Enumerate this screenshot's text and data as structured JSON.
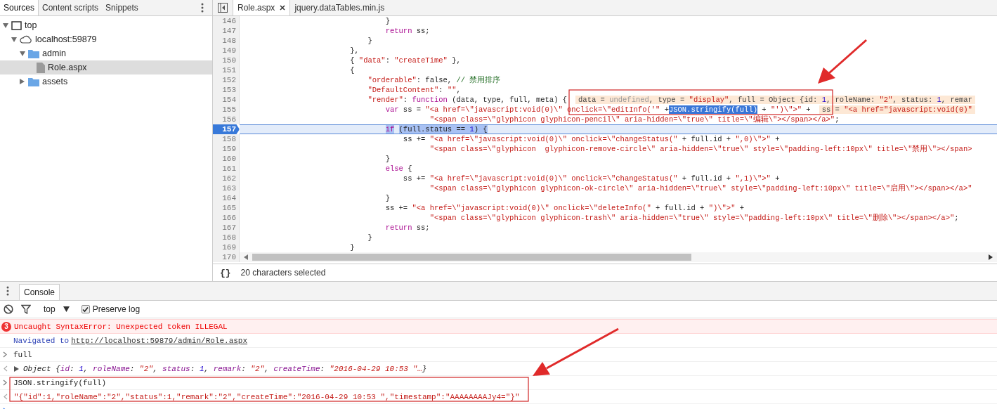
{
  "navigator": {
    "tabs": [
      {
        "label": "Sources",
        "selected": true
      },
      {
        "label": "Content scripts",
        "selected": false
      },
      {
        "label": "Snippets",
        "selected": false
      }
    ],
    "tree": [
      {
        "label": "top",
        "kind": "frame",
        "expanded": true,
        "selected": false,
        "children": [
          {
            "label": "localhost:59879",
            "kind": "cloud",
            "expanded": true,
            "selected": false,
            "children": [
              {
                "label": "admin",
                "kind": "folder",
                "expanded": true,
                "selected": false,
                "children": [
                  {
                    "label": "Role.aspx",
                    "kind": "file",
                    "selected": true
                  }
                ]
              },
              {
                "label": "assets",
                "kind": "folder",
                "expanded": false,
                "selected": false
              }
            ]
          }
        ]
      }
    ]
  },
  "editor": {
    "tabs": [
      {
        "label": "Role.aspx",
        "selected": true,
        "closable": true
      },
      {
        "label": "jquery.dataTables.min.js",
        "selected": false,
        "closable": false
      }
    ],
    "lines": [
      {
        "number": "146",
        "paused": false,
        "tokens": [
          {
            "kind": "plain",
            "text": "                                }"
          }
        ]
      },
      {
        "number": "147",
        "paused": false,
        "tokens": [
          {
            "kind": "keyword",
            "text": "                                return"
          },
          {
            "kind": "plain",
            "text": " ss;"
          }
        ]
      },
      {
        "number": "148",
        "paused": false,
        "tokens": [
          {
            "kind": "plain",
            "text": "                            }"
          }
        ]
      },
      {
        "number": "149",
        "paused": false,
        "tokens": [
          {
            "kind": "plain",
            "text": "                        },"
          }
        ]
      },
      {
        "number": "150",
        "paused": false,
        "tokens": [
          {
            "kind": "plain",
            "text": "                        { "
          },
          {
            "kind": "string",
            "text": "\"data\""
          },
          {
            "kind": "plain",
            "text": ": "
          },
          {
            "kind": "string",
            "text": "\"createTime\""
          },
          {
            "kind": "plain",
            "text": " },"
          }
        ]
      },
      {
        "number": "151",
        "paused": false,
        "tokens": [
          {
            "kind": "plain",
            "text": "                        {"
          }
        ]
      },
      {
        "number": "152",
        "paused": false,
        "tokens": [
          {
            "kind": "string",
            "text": "                            \"orderable\""
          },
          {
            "kind": "plain",
            "text": ": false, "
          },
          {
            "kind": "comment",
            "text": "// 禁用排序"
          }
        ]
      },
      {
        "number": "153",
        "paused": false,
        "tokens": [
          {
            "kind": "string",
            "text": "                            \"DefaultContent\""
          },
          {
            "kind": "plain",
            "text": ": "
          },
          {
            "kind": "string",
            "text": "\"\""
          },
          {
            "kind": "plain",
            "text": ","
          }
        ]
      },
      {
        "number": "154",
        "paused": false,
        "tokens": [
          {
            "kind": "string",
            "text": "                            \"render\""
          },
          {
            "kind": "plain",
            "text": ": "
          },
          {
            "kind": "keyword",
            "text": "function"
          },
          {
            "kind": "plain",
            "text": " (data, type, full, meta) {"
          }
        ],
        "hint": [
          {
            "kind": "plain",
            "text": "data = "
          },
          {
            "kind": "muted",
            "text": "undefined"
          },
          {
            "kind": "plain",
            "text": ", type = "
          },
          {
            "kind": "string",
            "text": "\"display\""
          },
          {
            "kind": "plain",
            "text": ", full = Object {id: "
          },
          {
            "kind": "number",
            "text": "1"
          },
          {
            "kind": "plain",
            "text": ", roleName: "
          },
          {
            "kind": "string",
            "text": "\"2\""
          },
          {
            "kind": "plain",
            "text": ", status: "
          },
          {
            "kind": "number",
            "text": "1"
          },
          {
            "kind": "plain",
            "text": ", remar"
          }
        ]
      },
      {
        "number": "155",
        "paused": false,
        "tokens": [
          {
            "kind": "keyword",
            "text": "                                var"
          },
          {
            "kind": "plain",
            "text": " ss = "
          },
          {
            "kind": "string",
            "text": "\"<a href=\\\"javascript:void(0)\\\" onclick=\\\"editInfo('\""
          },
          {
            "kind": "plain",
            "text": " +"
          },
          {
            "kind": "selected",
            "text": "JSON.stringify(full)"
          },
          {
            "kind": "plain",
            "text": " + "
          },
          {
            "kind": "string",
            "text": "\"')\\\">\""
          },
          {
            "kind": "plain",
            "text": " +"
          }
        ],
        "hint": [
          {
            "kind": "plain",
            "text": "ss = "
          },
          {
            "kind": "string",
            "text": "\"<a href=\"javascript:void(0)\""
          }
        ]
      },
      {
        "number": "156",
        "paused": false,
        "tokens": [
          {
            "kind": "string",
            "text": "                                          \"<span class=\\\"glyphicon glyphicon-pencil\\\" aria-hidden=\\\"true\\\" title=\\\"编辑\\\"></span></a>\""
          },
          {
            "kind": "plain",
            "text": ";"
          }
        ]
      },
      {
        "number": "157",
        "paused": true,
        "tokens": [
          {
            "kind": "keyword",
            "text": "                                if"
          },
          {
            "kind": "plain",
            "text": " (full.status == "
          },
          {
            "kind": "number",
            "text": "1"
          },
          {
            "kind": "plain",
            "text": ") {"
          }
        ]
      },
      {
        "number": "158",
        "paused": false,
        "tokens": [
          {
            "kind": "plain",
            "text": "                                    ss += "
          },
          {
            "kind": "string",
            "text": "\"<a href=\\\"javascript:void(0)\\\" onclick=\\\"changeStatus(\""
          },
          {
            "kind": "plain",
            "text": " + full.id + "
          },
          {
            "kind": "string",
            "text": "\",0)\\\">\""
          },
          {
            "kind": "plain",
            "text": " +"
          }
        ]
      },
      {
        "number": "159",
        "paused": false,
        "tokens": [
          {
            "kind": "string",
            "text": "                                          \"<span class=\\\"glyphicon  glyphicon-remove-circle\\\" aria-hidden=\\\"true\\\" style=\\\"padding-left:10px\\\" title=\\\"禁用\\\"></span>"
          }
        ]
      },
      {
        "number": "160",
        "paused": false,
        "tokens": [
          {
            "kind": "plain",
            "text": "                                }"
          }
        ]
      },
      {
        "number": "161",
        "paused": false,
        "tokens": [
          {
            "kind": "keyword",
            "text": "                                else"
          },
          {
            "kind": "plain",
            "text": " {"
          }
        ]
      },
      {
        "number": "162",
        "paused": false,
        "tokens": [
          {
            "kind": "plain",
            "text": "                                    ss += "
          },
          {
            "kind": "string",
            "text": "\"<a href=\\\"javascript:void(0)\\\" onclick=\\\"changeStatus(\""
          },
          {
            "kind": "plain",
            "text": " + full.id + "
          },
          {
            "kind": "string",
            "text": "\",1)\\\">\""
          },
          {
            "kind": "plain",
            "text": " +"
          }
        ]
      },
      {
        "number": "163",
        "paused": false,
        "tokens": [
          {
            "kind": "string",
            "text": "                                          \"<span class=\\\"glyphicon glyphicon-ok-circle\\\" aria-hidden=\\\"true\\\" style=\\\"padding-left:10px\\\" title=\\\"启用\\\"></span></a>\""
          }
        ]
      },
      {
        "number": "164",
        "paused": false,
        "tokens": [
          {
            "kind": "plain",
            "text": "                                }"
          }
        ]
      },
      {
        "number": "165",
        "paused": false,
        "tokens": [
          {
            "kind": "plain",
            "text": "                                ss += "
          },
          {
            "kind": "string",
            "text": "\"<a href=\\\"javascript:void(0)\\\" onclick=\\\"deleteInfo(\""
          },
          {
            "kind": "plain",
            "text": " + full.id + "
          },
          {
            "kind": "string",
            "text": "\")\\\">\""
          },
          {
            "kind": "plain",
            "text": " +"
          }
        ]
      },
      {
        "number": "166",
        "paused": false,
        "tokens": [
          {
            "kind": "string",
            "text": "                                          \"<span class=\\\"glyphicon glyphicon-trash\\\" aria-hidden=\\\"true\\\" style=\\\"padding-left:10px\\\" title=\\\"删除\\\"></span></a>\""
          },
          {
            "kind": "plain",
            "text": ";"
          }
        ]
      },
      {
        "number": "167",
        "paused": false,
        "tokens": [
          {
            "kind": "keyword",
            "text": "                                return"
          },
          {
            "kind": "plain",
            "text": " ss;"
          }
        ]
      },
      {
        "number": "168",
        "paused": false,
        "tokens": [
          {
            "kind": "plain",
            "text": "                            }"
          }
        ]
      },
      {
        "number": "169",
        "paused": false,
        "tokens": [
          {
            "kind": "plain",
            "text": "                        }"
          }
        ]
      }
    ],
    "last_line": {
      "number": "170"
    },
    "format_button": "{}",
    "status": "20 characters selected"
  },
  "console": {
    "tab": "Console",
    "context": "top",
    "preserve_log": {
      "label": "Preserve log",
      "checked": true
    },
    "messages": [
      {
        "kind": "error",
        "count": "3",
        "text": "Uncaught SyntaxError: Unexpected token ILLEGAL"
      },
      {
        "kind": "navigation",
        "text": "Navigated to",
        "link": "http://localhost:59879/admin/Role.aspx"
      },
      {
        "kind": "input",
        "text": "full"
      },
      {
        "kind": "object",
        "tokens": [
          {
            "kind": "plain",
            "text": "Object {"
          },
          {
            "kind": "key",
            "text": "id"
          },
          {
            "kind": "plain",
            "text": ": "
          },
          {
            "kind": "number",
            "text": "1"
          },
          {
            "kind": "plain",
            "text": ", "
          },
          {
            "kind": "key",
            "text": "roleName"
          },
          {
            "kind": "plain",
            "text": ": "
          },
          {
            "kind": "string",
            "text": "\"2\""
          },
          {
            "kind": "plain",
            "text": ", "
          },
          {
            "kind": "key",
            "text": "status"
          },
          {
            "kind": "plain",
            "text": ": "
          },
          {
            "kind": "number",
            "text": "1"
          },
          {
            "kind": "plain",
            "text": ", "
          },
          {
            "kind": "key",
            "text": "remark"
          },
          {
            "kind": "plain",
            "text": ": "
          },
          {
            "kind": "string",
            "text": "\"2\""
          },
          {
            "kind": "plain",
            "text": ", "
          },
          {
            "kind": "key",
            "text": "createTime"
          },
          {
            "kind": "plain",
            "text": ": "
          },
          {
            "kind": "string",
            "text": "\"2016-04-29 10:53 \"…"
          },
          {
            "kind": "plain",
            "text": "}"
          }
        ]
      },
      {
        "kind": "input",
        "text": "JSON.stringify(full)"
      },
      {
        "kind": "string",
        "text": "\"{\"id\":1,\"roleName\":\"2\",\"status\":1,\"remark\":\"2\",\"createTime\":\"2016-04-29 10:53 \",\"timestamp\":\"AAAAAAAAJy4=\"}\""
      }
    ]
  }
}
